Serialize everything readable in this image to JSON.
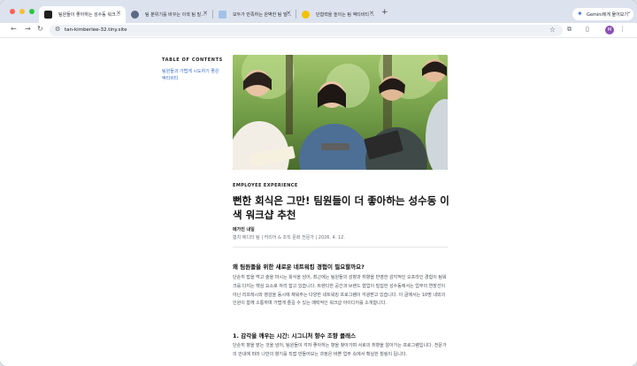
{
  "browser": {
    "tabs": [
      {
        "label": "팀원들이 좋아하는 성수동 워크…",
        "favicon_color": "#1f1f1f",
        "active": true
      },
      {
        "label": "팀 분위기를 바꾸는 이색 팀 빌…",
        "favicon_color": "#5b6b85",
        "active": false
      },
      {
        "label": "모두가 만족하는 완벽한 팀 빌…",
        "favicon_color": "#a3c0e8",
        "active": false
      },
      {
        "label": "단합력을 높이는 팀 액티비티 …",
        "favicon_color": "#f2c200",
        "active": false
      }
    ],
    "new_tab": "+",
    "gemini_label": "Gemini에게 물어보기",
    "url": "tan-kimberlee-32.tiny.site",
    "avatar_letter": "M"
  },
  "toc": {
    "title": "TABLE OF CONTENTS",
    "items": [
      "팀원들과 가볍게 시도하기 좋은 액티비티"
    ]
  },
  "article": {
    "category": "EMPLOYEE EXPERIENCE",
    "title": "뻔한 회식은 그만! 팀원들이 더 좋아하는 성수동 이색 워크샵 추천",
    "author": "메가진 내일",
    "meta": "협치 에디터 팀 | 커리어 & 조직 문화 전문가 | 2026. 4. 12.",
    "sections": [
      {
        "heading": "왜 팀원들을 위한 새로운 네트워킹 경험이 필요할까요?",
        "body": "단순히 밥을 먹고 술을 마시는 회식을 넘어, 최근에는 팀원들의 성향과 취향을 반영한 감각적인 오프라인 경험이 팀워크를 다지는 핵심 요소로 자리 잡고 있습니다. 트렌디한 공간과 브랜드 협업이 밀집한 성수동에서는 업무의 연장선이 아닌 리프레시와 영감을 동시에 채워주는 다양한 네트워킹 프로그램이 각광받고 있습니다. 이 글에서는 10명 내외의 인원이 함께 소통하며 가볍게 즐길 수 있는 매력적인 워크샵 아이디어를 소개합니다."
      },
      {
        "heading": "1. 감각을 깨우는 시간: 시그니처 향수 조향 클래스",
        "body": "단순히 향을 맡는 것을 넘어, 팀원들이 각자 좋아하는 향을 찾아가며 서로의 취향을 알아가는 프로그램입니다. 전문가의 안내에 따라 나만의 향기를 직접 만들어보는 과정은 바쁜 업무 속에서 확실한 힐링이 됩니다."
      }
    ]
  }
}
